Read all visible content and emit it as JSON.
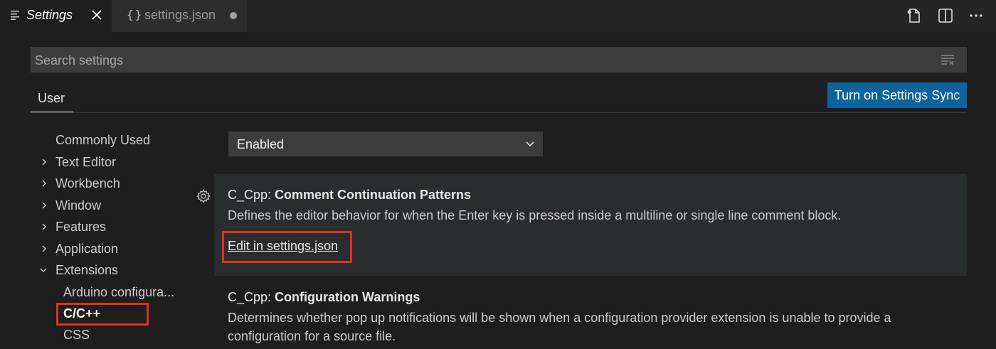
{
  "tabs": [
    {
      "title": "Settings",
      "icon": "settings-editor-icon",
      "close_icon": "close-icon"
    },
    {
      "title": "settings.json",
      "icon": "json-braces-icon",
      "braces": "{}",
      "modified_indicator": "dirty-dot-icon"
    }
  ],
  "title_actions": [
    "open-settings-json-icon",
    "split-editor-icon",
    "more-actions-icon"
  ],
  "search": {
    "placeholder": "Search settings",
    "value": "",
    "filter_icon": "clear-filter-icon"
  },
  "scope": {
    "tab": "User",
    "sync_button": "Turn on Settings Sync"
  },
  "toc": [
    {
      "label": "Commonly Used",
      "expandable": false
    },
    {
      "label": "Text Editor",
      "expandable": true,
      "expanded": false
    },
    {
      "label": "Workbench",
      "expandable": true,
      "expanded": false
    },
    {
      "label": "Window",
      "expandable": true,
      "expanded": false
    },
    {
      "label": "Features",
      "expandable": true,
      "expanded": false
    },
    {
      "label": "Application",
      "expandable": true,
      "expanded": false
    },
    {
      "label": "Extensions",
      "expandable": true,
      "expanded": true
    },
    {
      "label": "Arduino configura...",
      "child": true
    },
    {
      "label": "C/C++",
      "child": true,
      "selected": true
    },
    {
      "label": "CSS",
      "child": true
    }
  ],
  "settings": {
    "dropdown_value": "Enabled",
    "comment_patterns": {
      "category": "C_Cpp: ",
      "name": "Comment Continuation Patterns",
      "description": "Defines the editor behavior for when the Enter key is pressed inside a multiline or single line comment block.",
      "link": "Edit in settings.json"
    },
    "config_warnings": {
      "category": "C_Cpp: ",
      "name": "Configuration Warnings",
      "description_line1": "Determines whether pop up notifications will be shown when a configuration provider extension is unable to provide a",
      "description_line2": "configuration for a source file."
    }
  },
  "colors": {
    "accent_button": "#0e639c",
    "highlight": "#e0301e",
    "background": "#1e1e1e"
  }
}
